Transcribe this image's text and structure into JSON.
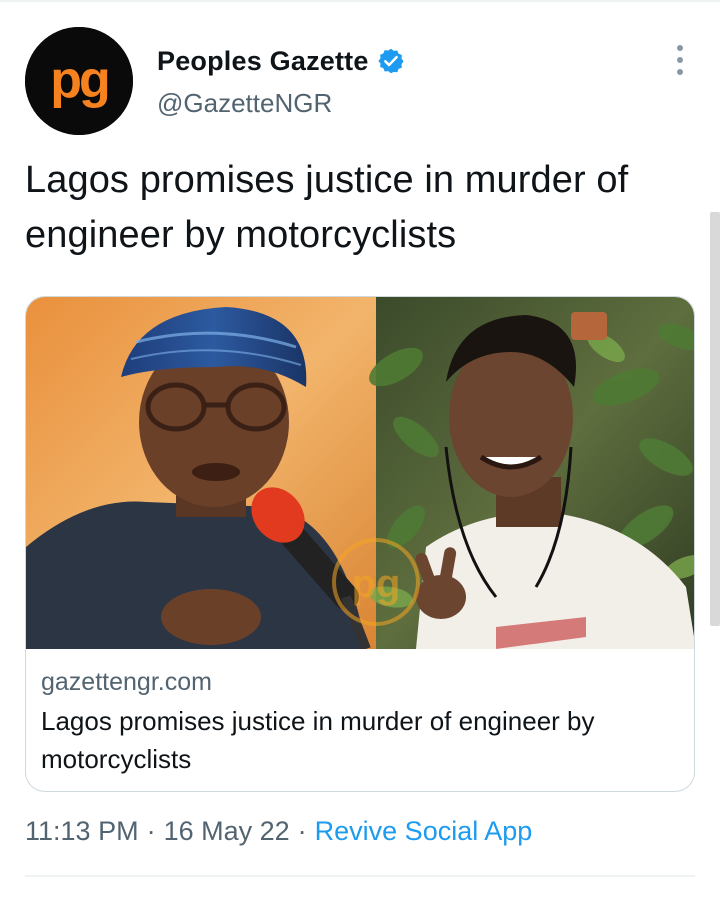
{
  "tweet": {
    "author": {
      "display_name": "Peoples Gazette",
      "handle": "@GazetteNGR",
      "avatar_logo_text": "pg",
      "verified": true
    },
    "text": "Lagos promises justice in murder of engineer by motorcyclists",
    "link_card": {
      "domain": "gazettengr.com",
      "title": "Lagos promises justice in murder of engineer by motorcyclists",
      "watermark_text": "pg"
    },
    "time": "11:13 PM",
    "separator": "·",
    "date": "16 May 22",
    "source": "Revive Social App"
  },
  "icons": {
    "verified": "verified-badge-icon",
    "more": "more-options-icon"
  },
  "colors": {
    "link_blue": "#1d9bf0",
    "secondary_text": "#536471",
    "primary_text": "#0f1419",
    "brand_orange": "#f5821f",
    "avatar_bg": "#0a0a0a"
  }
}
